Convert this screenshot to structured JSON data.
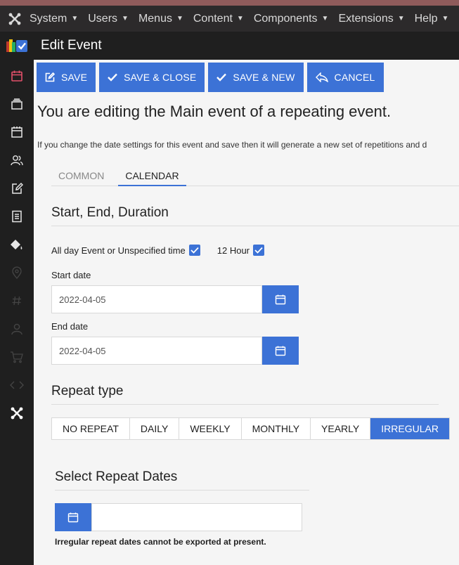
{
  "menu": {
    "items": [
      {
        "label": "System"
      },
      {
        "label": "Users"
      },
      {
        "label": "Menus"
      },
      {
        "label": "Content"
      },
      {
        "label": "Components"
      },
      {
        "label": "Extensions"
      },
      {
        "label": "Help"
      }
    ]
  },
  "header": {
    "title": "Edit Event"
  },
  "sidebar": {
    "icons": [
      "calendar-icon",
      "layers-icon",
      "calendar-grid-icon",
      "users-icon",
      "edit-icon",
      "document-icon",
      "paint-bucket-icon",
      "location-icon",
      "hash-icon",
      "user-icon",
      "cart-icon",
      "code-icon",
      "joomla-icon"
    ]
  },
  "toolbar": {
    "save": "SAVE",
    "save_close": "SAVE & CLOSE",
    "save_new": "SAVE & NEW",
    "cancel": "CANCEL"
  },
  "notice": {
    "title": "You are editing the Main event of a repeating event.",
    "text": "If you change the date settings for this event and save then it will generate a new set of repetitions and d"
  },
  "tabs": [
    {
      "label": "COMMON",
      "active": false
    },
    {
      "label": "CALENDAR",
      "active": true
    }
  ],
  "section": {
    "heading": "Start, End, Duration"
  },
  "options": {
    "allday_label": "All day Event or Unspecified time",
    "allday_checked": true,
    "twelve_hour_label": "12 Hour",
    "twelve_hour_checked": true
  },
  "start": {
    "label": "Start date",
    "value": "2022-04-05"
  },
  "end": {
    "label": "End date",
    "value": "2022-04-05"
  },
  "repeat": {
    "heading": "Repeat type",
    "options": [
      "NO REPEAT",
      "DAILY",
      "WEEKLY",
      "MONTHLY",
      "YEARLY",
      "IRREGULAR"
    ],
    "selected": "IRREGULAR"
  },
  "irregular": {
    "heading": "Select Repeat Dates",
    "note": "Irregular repeat dates cannot be exported at present.",
    "value": ""
  },
  "colors": {
    "accent": "#3c72d6",
    "topbar": "#2c2a2b",
    "topbar_border": "#8f5b5b",
    "sidebar": "#1f1f1f",
    "active_icon": "#e2506a"
  }
}
